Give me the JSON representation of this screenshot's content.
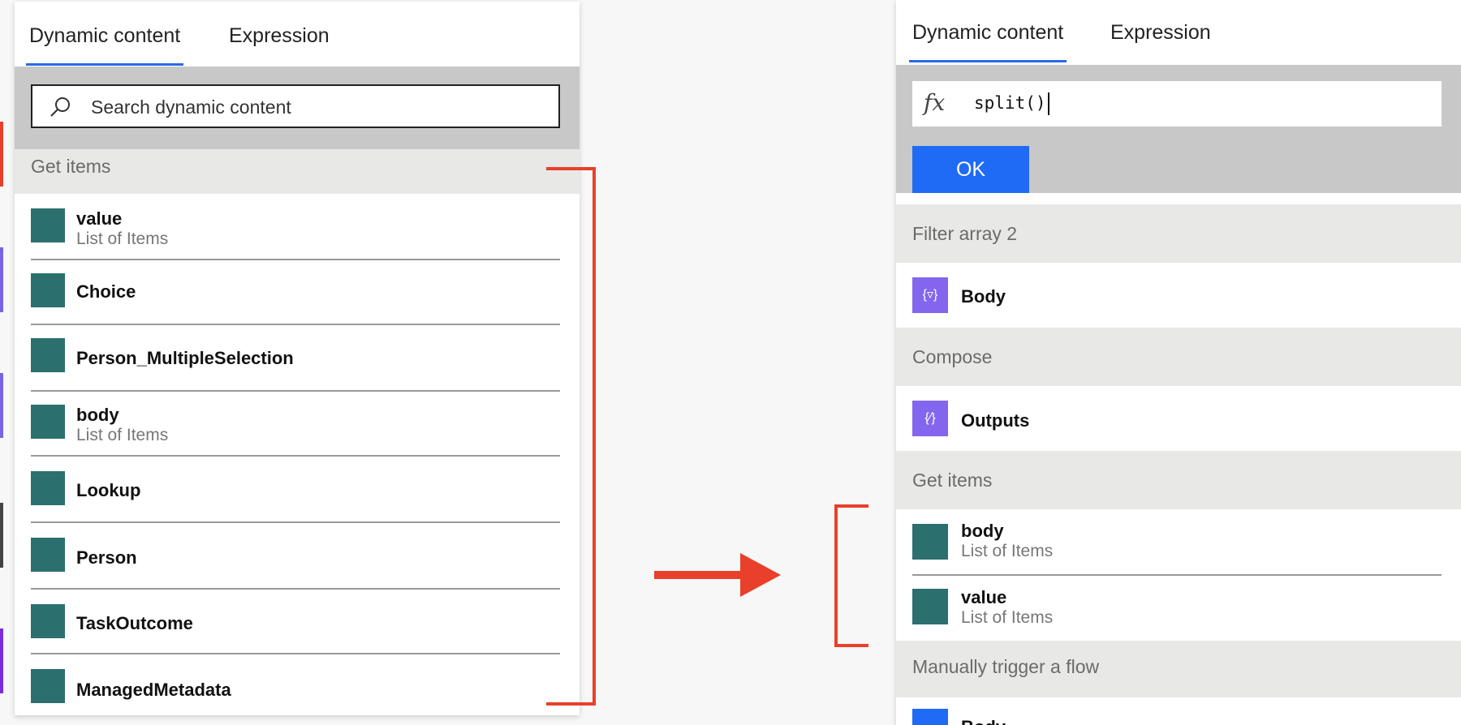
{
  "left_panel": {
    "tabs": {
      "dynamic": "Dynamic content",
      "expression": "Expression"
    },
    "search": {
      "placeholder": "Search dynamic content"
    },
    "group": "Get items",
    "items": [
      {
        "title": "value",
        "subtitle": "List of Items"
      },
      {
        "title": "Choice"
      },
      {
        "title": "Person_MultipleSelection"
      },
      {
        "title": "body",
        "subtitle": "List of Items"
      },
      {
        "title": "Lookup"
      },
      {
        "title": "Person"
      },
      {
        "title": "TaskOutcome"
      },
      {
        "title": "ManagedMetadata"
      }
    ]
  },
  "right_panel": {
    "tabs": {
      "dynamic": "Dynamic content",
      "expression": "Expression"
    },
    "expression_value": "split()",
    "ok_label": "OK",
    "groups": [
      {
        "header": "Filter array 2",
        "items": [
          {
            "title": "Body"
          }
        ]
      },
      {
        "header": "Compose",
        "items": [
          {
            "title": "Outputs"
          }
        ]
      },
      {
        "header": "Get items",
        "items": [
          {
            "title": "body",
            "subtitle": "List of Items"
          },
          {
            "title": "value",
            "subtitle": "List of Items"
          }
        ]
      },
      {
        "header": "Manually trigger a flow",
        "items": [
          {
            "title": "Body"
          }
        ]
      }
    ]
  },
  "colors": {
    "accent_blue": "#2a6ae8",
    "annotation_red": "#e8402a",
    "sharepoint_teal": "#2c6f6f",
    "action_purple": "#8466ee"
  }
}
